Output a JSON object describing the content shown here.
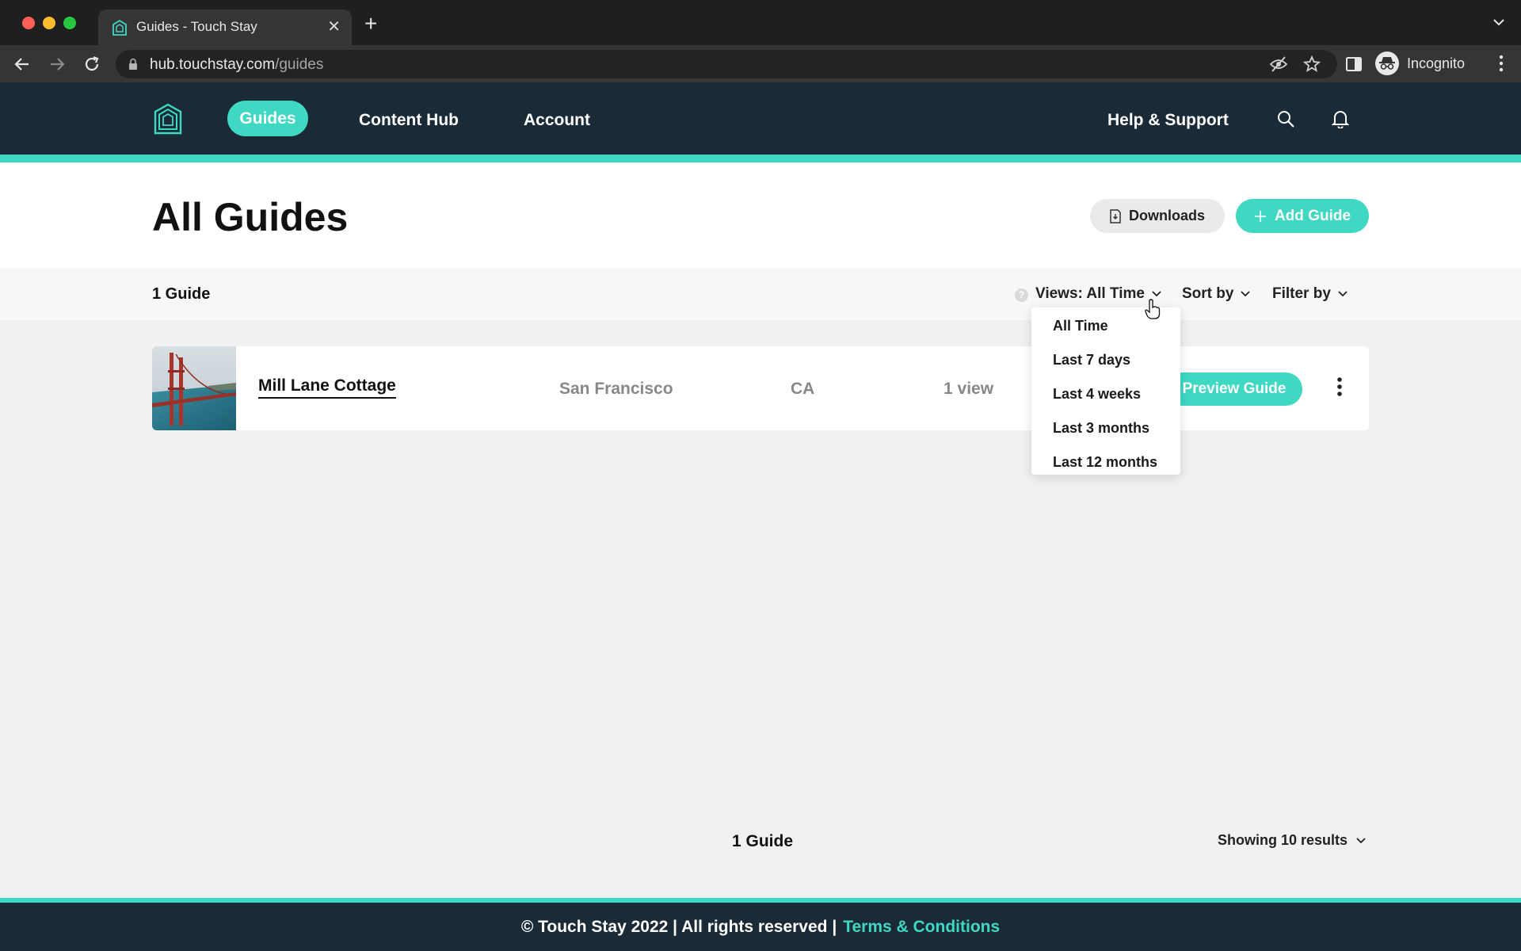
{
  "browser": {
    "tab_title": "Guides - Touch Stay",
    "url_host": "hub.touchstay.com",
    "url_path": "/guides",
    "profile_label": "Incognito"
  },
  "nav": {
    "items": [
      {
        "label": "Guides",
        "active": true
      },
      {
        "label": "Content Hub"
      },
      {
        "label": "Account"
      }
    ],
    "help_label": "Help & Support"
  },
  "page": {
    "title": "All Guides",
    "downloads_label": "Downloads",
    "add_label": "Add Guide"
  },
  "filters": {
    "count": "1 Guide",
    "help_glyph": "?",
    "views_label": "Views: All Time",
    "sort_label": "Sort by",
    "filter_label": "Filter by",
    "views_options": [
      "All Time",
      "Last 7 days",
      "Last 4 weeks",
      "Last 3 months",
      "Last 12 months"
    ]
  },
  "guides": [
    {
      "name": "Mill Lane Cottage",
      "city": "San Francisco",
      "state": "CA",
      "views": "1 view",
      "preview_label": "Preview Guide"
    }
  ],
  "pagination": {
    "count": "1 Guide",
    "showing": "Showing 10 results"
  },
  "footer": {
    "copyright": "© Touch Stay 2022 | All rights reserved |",
    "terms": "Terms & Conditions"
  },
  "colors": {
    "accent": "#3fd8c2",
    "nav_bg": "#1b2a37",
    "page_bg": "#f1f1f1"
  }
}
